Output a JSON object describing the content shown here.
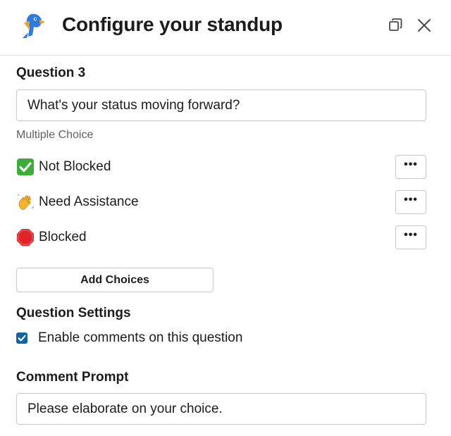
{
  "header": {
    "title": "Configure your standup",
    "logo_icon": "parrot-logo-icon",
    "maximize_icon": "maximize-icon",
    "close_icon": "close-icon"
  },
  "question": {
    "label": "Question 3",
    "value": "What's your status moving forward?",
    "type_label": "Multiple Choice"
  },
  "choices": [
    {
      "emoji": "white-check-mark-icon",
      "label": "Not Blocked",
      "menu_label": "•••"
    },
    {
      "emoji": "waving-hand-icon",
      "label": "Need Assistance",
      "menu_label": "•••"
    },
    {
      "emoji": "stop-sign-icon",
      "label": "Blocked",
      "menu_label": "•••"
    }
  ],
  "add_choices_label": "Add Choices",
  "settings": {
    "label": "Question Settings",
    "enable_comments_label": "Enable comments on this question",
    "enable_comments_checked": true
  },
  "comment_prompt": {
    "label": "Comment Prompt",
    "value": "Please elaborate on your choice."
  },
  "colors": {
    "accent": "#1264a3",
    "check_green": "#3dad3a",
    "stop_red": "#e0242a",
    "hand_yellow": "#f7b52c"
  }
}
